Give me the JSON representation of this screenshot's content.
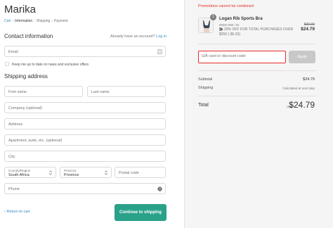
{
  "store": {
    "name": "Marika"
  },
  "breadcrumb": {
    "items": [
      "Cart",
      "Information",
      "Shipping",
      "Payment"
    ],
    "separator": "›"
  },
  "contact": {
    "title": "Contact information",
    "have_account": "Already have an account?",
    "login_label": "Log in",
    "email_placeholder": "Email",
    "newsletter_label": "Keep me up to date on news and exclusive offers"
  },
  "shipping": {
    "title": "Shipping address",
    "first_name": "First name",
    "last_name": "Last name",
    "company": "Company (optional)",
    "address": "Address",
    "apartment": "Apartment, suite, etc. (optional)",
    "city": "City",
    "country_label": "Country/Region",
    "country_value": "South Africa",
    "province_label": "Province",
    "province_value": "Province",
    "postal": "Postal code",
    "phone": "Phone"
  },
  "actions": {
    "return_label": "‹ Return to cart",
    "continue_label": "Continue to shipping"
  },
  "summary": {
    "promo_error": "Promotions cannot be combined",
    "product": {
      "name": "Logan Rib Sports Bra",
      "variant": "INDIA INK / M",
      "quantity": "1",
      "discount": "20% OFF FOR TOTAL PURCHASES OVER $250 (-$6.20)",
      "price_original": "$30.99",
      "price_now": "$24.79"
    },
    "gift_placeholder": "Gift card or discount code",
    "apply_label": "Apply",
    "subtotal_label": "Subtotal",
    "subtotal_value": "$24.79",
    "shipping_label": "Shipping",
    "shipping_value": "Calculated at next step",
    "total_label": "Total",
    "currency": "USD",
    "total_value": "$24.79"
  },
  "colors": {
    "accent": "#2aa189",
    "link": "#338dbc",
    "error": "#e32c2b"
  }
}
